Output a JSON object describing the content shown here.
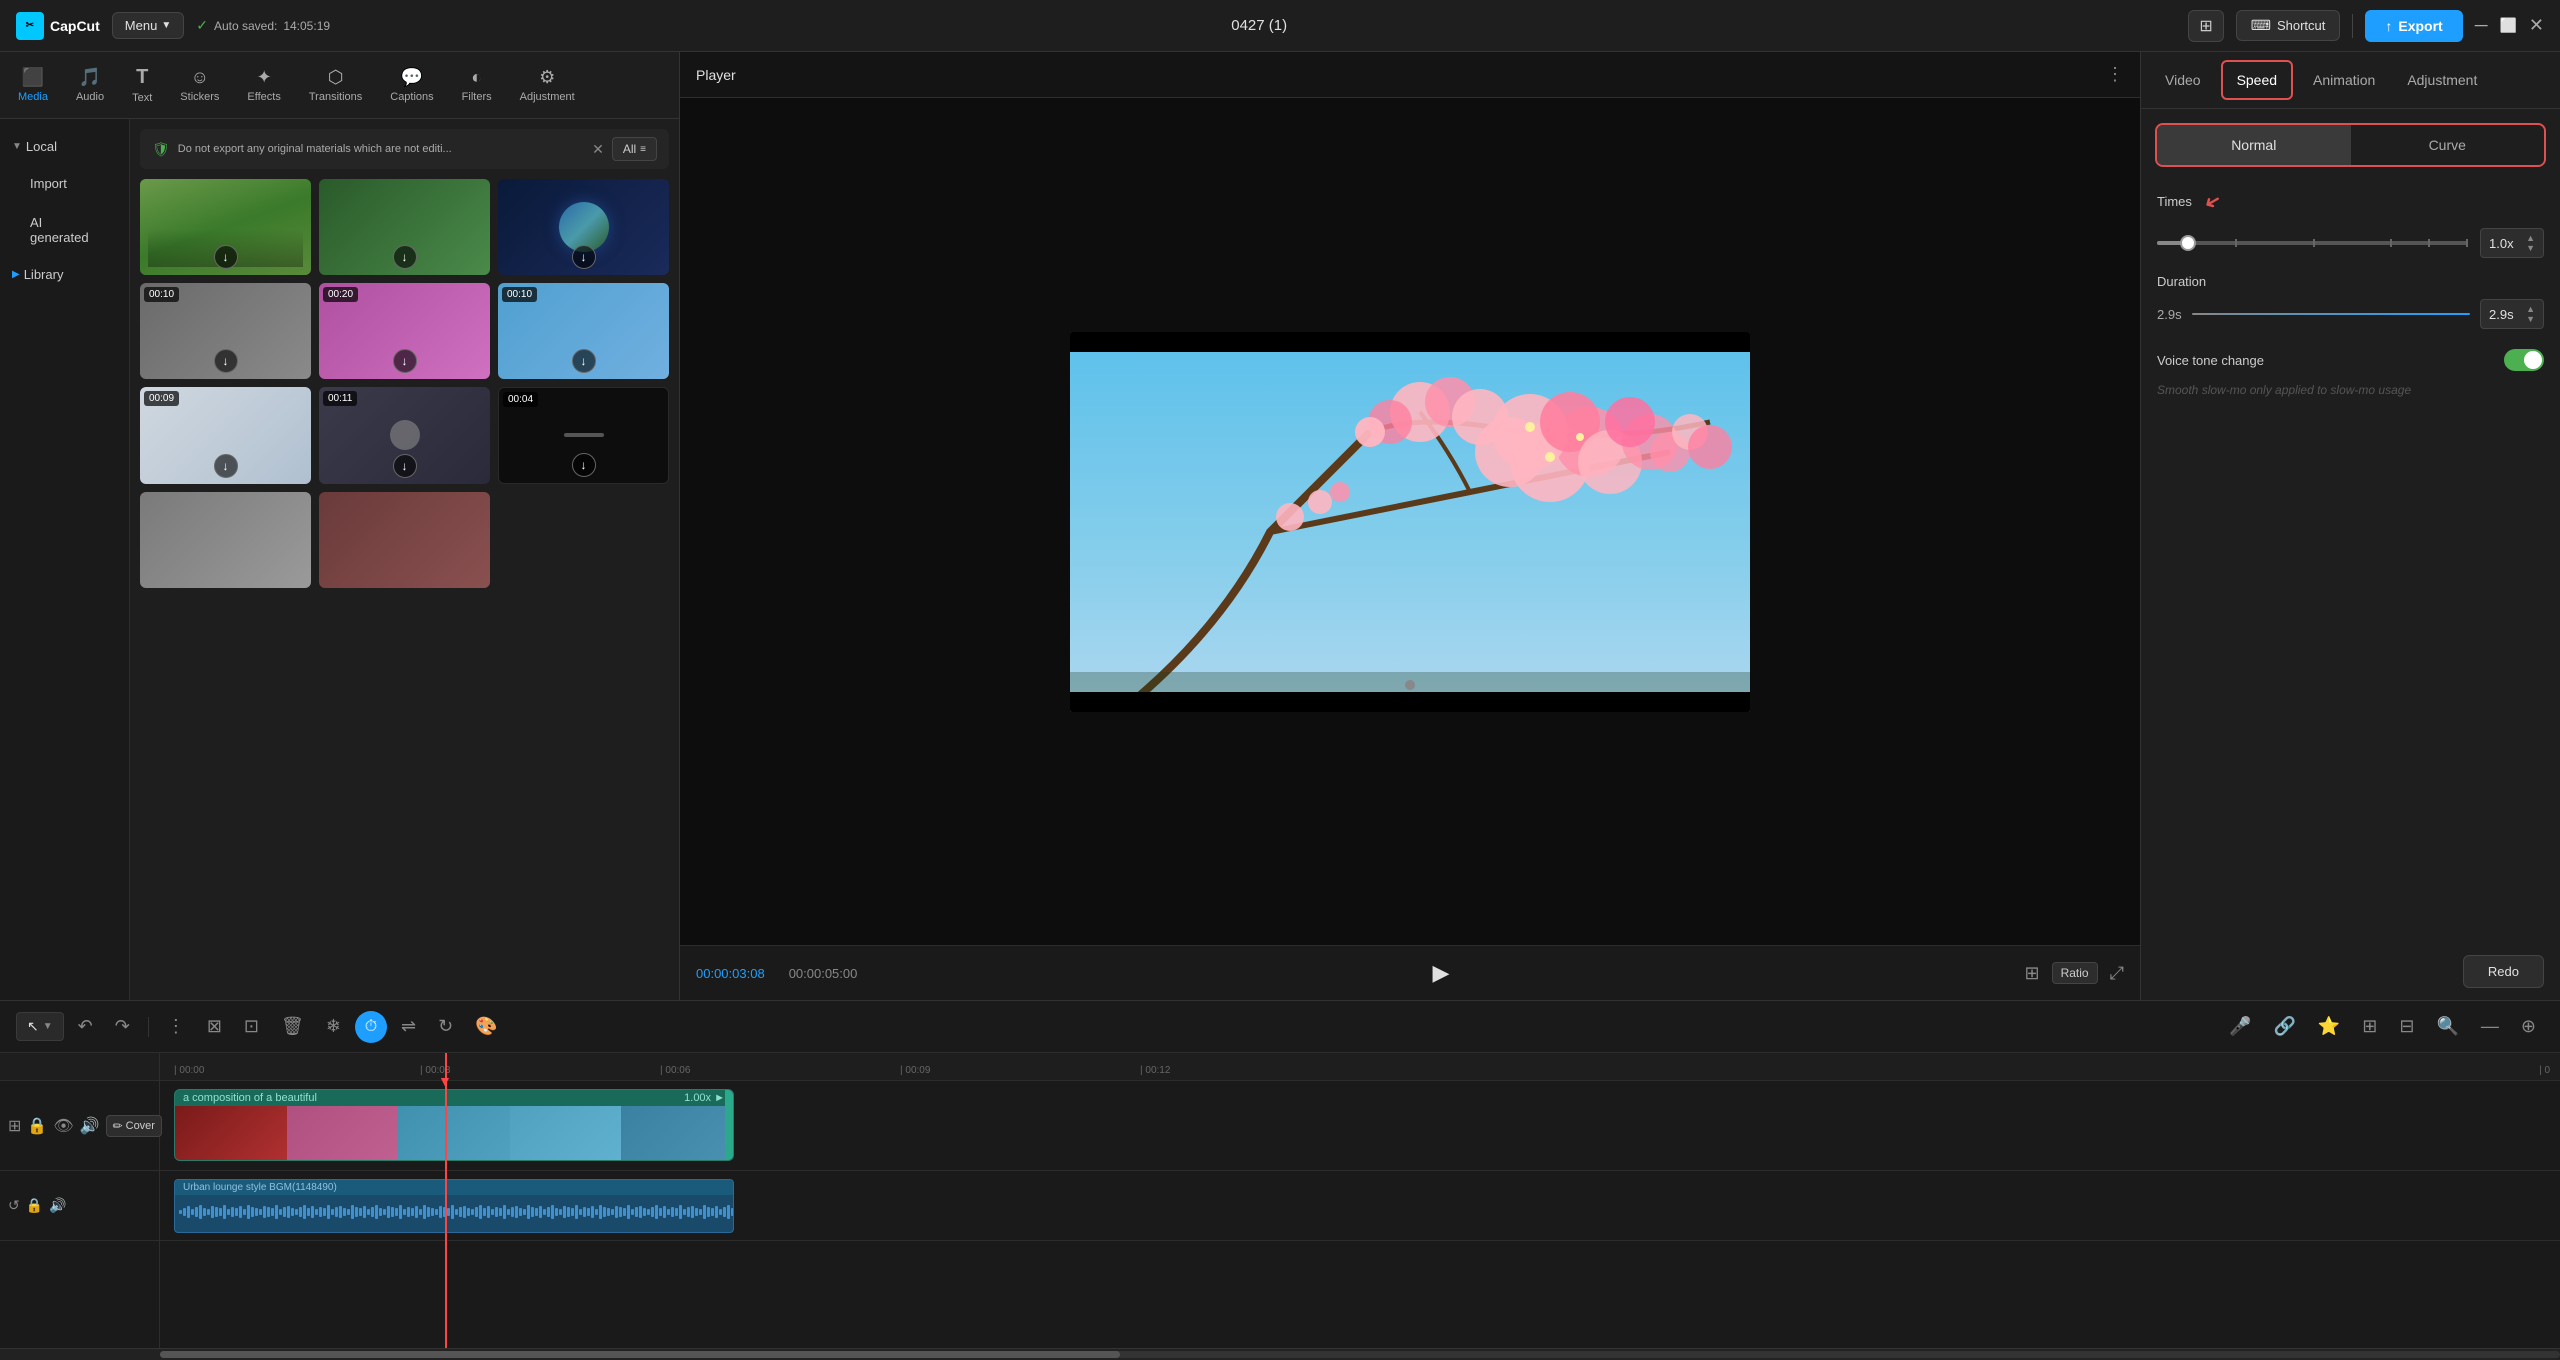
{
  "app": {
    "name": "CapCut",
    "menu_label": "Menu",
    "auto_saved_label": "Auto saved:",
    "auto_saved_time": "14:05:19",
    "title": "0427 (1)",
    "shortcut_label": "Shortcut",
    "export_label": "Export"
  },
  "toolbar": {
    "items": [
      {
        "id": "media",
        "label": "Media",
        "icon": "⬛",
        "active": true
      },
      {
        "id": "audio",
        "label": "Audio",
        "icon": "🎵"
      },
      {
        "id": "text",
        "label": "Text",
        "icon": "T"
      },
      {
        "id": "stickers",
        "label": "Stickers",
        "icon": "☺"
      },
      {
        "id": "effects",
        "label": "Effects",
        "icon": "✦"
      },
      {
        "id": "transitions",
        "label": "Transitions",
        "icon": "⬡"
      },
      {
        "id": "captions",
        "label": "Captions",
        "icon": "💬"
      },
      {
        "id": "filters",
        "label": "Filters",
        "icon": "◐"
      },
      {
        "id": "adjustment",
        "label": "Adjustment",
        "icon": "⚙"
      }
    ]
  },
  "sidebar": {
    "local_label": "Local",
    "import_label": "Import",
    "ai_generated_label": "AI generated",
    "library_label": "Library"
  },
  "media_notice": {
    "text": "Do not export any original materials which are not editi...",
    "all_label": "All"
  },
  "player": {
    "title": "Player",
    "time_current": "00:00:03:08",
    "time_total": "00:00:05:00",
    "ratio_label": "Ratio"
  },
  "right_panel": {
    "tabs": [
      "Video",
      "Speed",
      "Animation",
      "Adjustment"
    ],
    "active_tab": "Speed",
    "speed_tabs": [
      "Normal",
      "Curve"
    ],
    "active_speed_tab": "Normal",
    "times_label": "Times",
    "times_value": "1.0x",
    "times_min": "0.1",
    "times_max": "100",
    "times_position_pct": 10,
    "duration_label": "Duration",
    "duration_start": "2.9s",
    "duration_end": "2.9s",
    "voice_tone_label": "Voice tone change",
    "voice_tone_on": true,
    "smooth_slow_label": "Smooth slow-mo only applied to slow-mo usage",
    "redo_label": "Redo"
  },
  "timeline": {
    "ruler_marks": [
      "| 00:00",
      "| 00:03",
      "| 00:06",
      "| 00:09",
      "| 00:12",
      "| 0"
    ],
    "clip_label": "a composition of a beautiful",
    "clip_speed": "1.00x ►",
    "audio_label": "Urban lounge style BGM(1148490)",
    "cover_label": "Cover"
  }
}
